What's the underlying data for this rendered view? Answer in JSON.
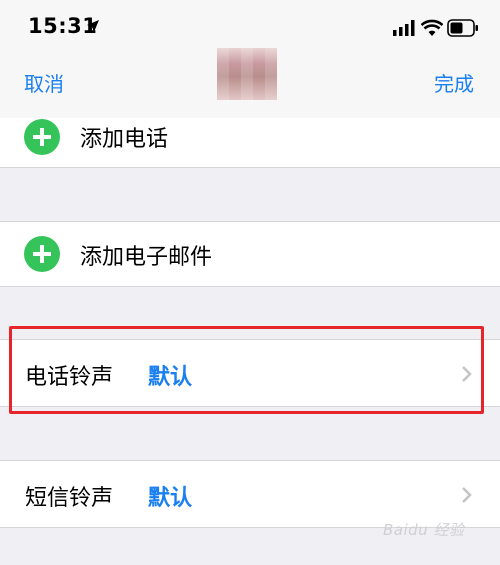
{
  "status_bar": {
    "time": "15:31"
  },
  "nav": {
    "cancel_label": "取消",
    "done_label": "完成"
  },
  "add_rows": {
    "phone_label": "添加电话",
    "email_label": "添加电子邮件"
  },
  "tones": [
    {
      "label": "电话铃声",
      "value": "默认"
    },
    {
      "label": "短信铃声",
      "value": "默认"
    }
  ],
  "colors": {
    "accent": "#1a7ff0",
    "add_green": "#35c45a",
    "highlight_red": "#e8242b",
    "background": "#efeff4"
  },
  "watermark": "Baidu 经验"
}
